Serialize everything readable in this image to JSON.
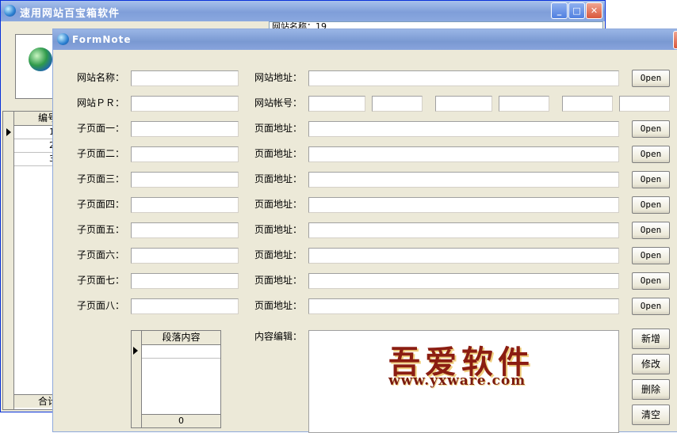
{
  "back_window": {
    "title": "速用网站百宝箱软件",
    "title_field_text": "网站名称：19",
    "grid": {
      "header": "编号",
      "rows": [
        "1",
        "2",
        "3"
      ],
      "footer": "合计"
    },
    "buttons": {
      "minimize": "_",
      "maximize": "□",
      "close": "✕"
    }
  },
  "form": {
    "title": "FormNote",
    "site_name_label": "网站名称：",
    "site_url_label": "网站地址：",
    "site_pr_label": "网站ＰＲ：",
    "site_account_label": "网站帐号：",
    "open_label": "Open",
    "subpages": [
      {
        "label": "子页面一：",
        "url_label": "页面地址："
      },
      {
        "label": "子页面二：",
        "url_label": "页面地址："
      },
      {
        "label": "子页面三：",
        "url_label": "页面地址："
      },
      {
        "label": "子页面四：",
        "url_label": "页面地址："
      },
      {
        "label": "子页面五：",
        "url_label": "页面地址："
      },
      {
        "label": "子页面六：",
        "url_label": "页面地址："
      },
      {
        "label": "子页面七：",
        "url_label": "页面地址："
      },
      {
        "label": "子页面八：",
        "url_label": "页面地址："
      }
    ],
    "paragraph_grid": {
      "header": "段落内容",
      "count": "0"
    },
    "content_edit_label": "内容编辑：",
    "actions": {
      "add": "新增",
      "edit": "修改",
      "delete": "删除",
      "clear": "清空"
    }
  },
  "watermark": {
    "text": "吾爱软件",
    "url": "www.yxware.com"
  }
}
